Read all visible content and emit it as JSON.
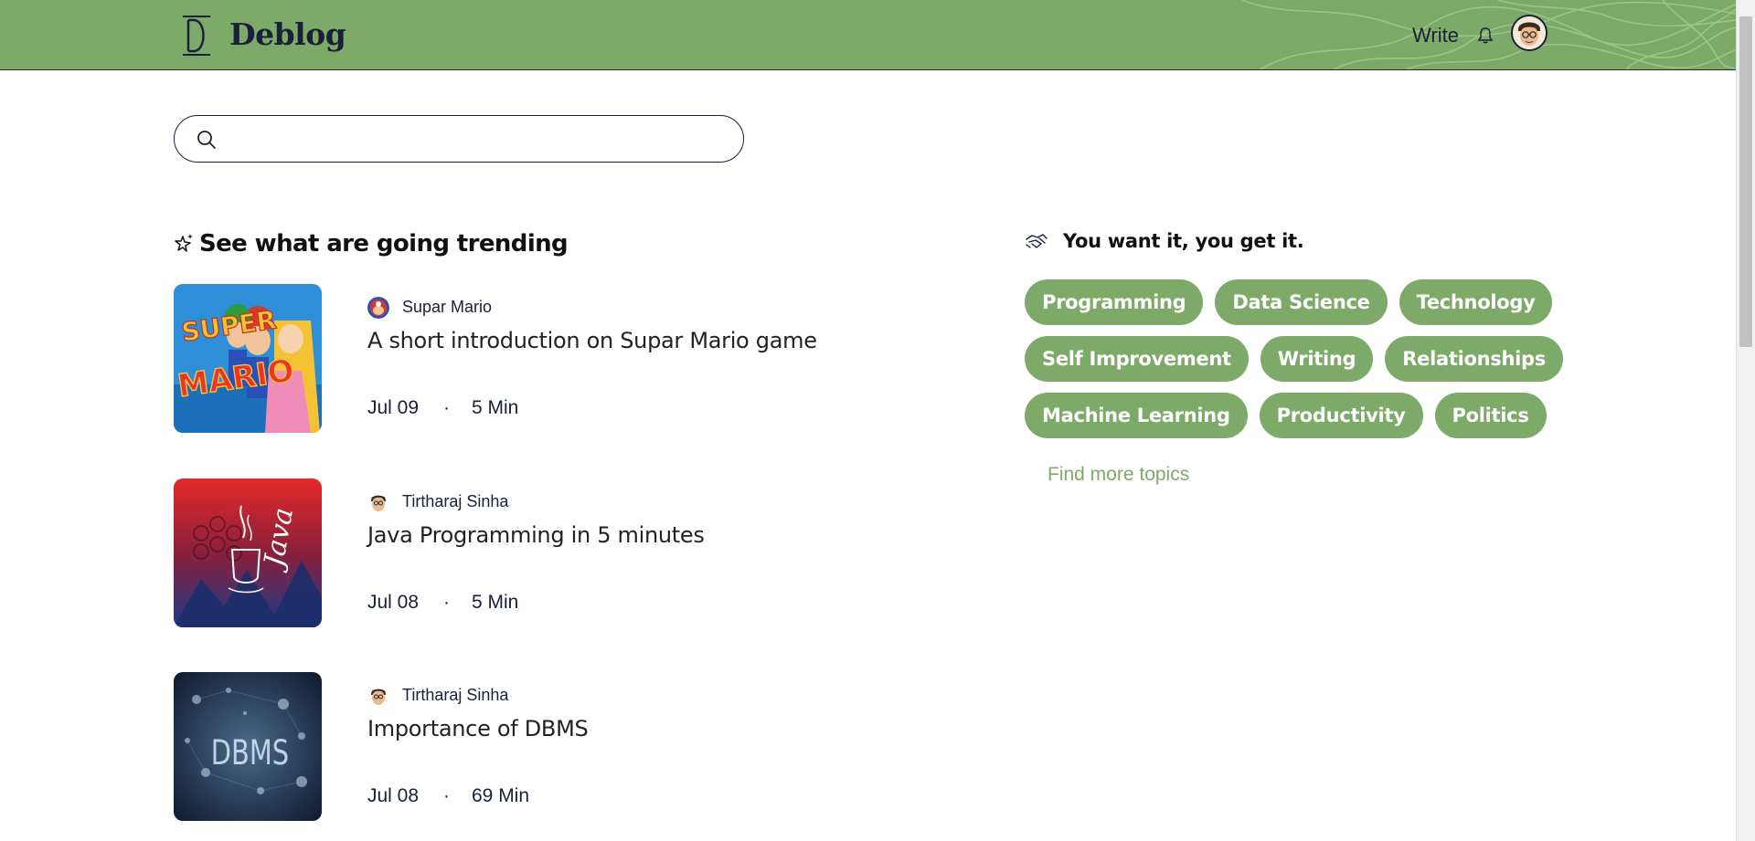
{
  "header": {
    "logo_text": "Deblog",
    "write_label": "Write"
  },
  "search": {
    "placeholder": ""
  },
  "trending": {
    "title": "See what are going trending",
    "posts": [
      {
        "author": "Supar Mario",
        "title": "A short introduction on Supar Mario game",
        "date": "Jul 09",
        "separator": "·",
        "read_time": "5 Min"
      },
      {
        "author": "Tirtharaj Sinha",
        "title": "Java Programming in 5 minutes",
        "date": "Jul 08",
        "separator": "·",
        "read_time": "5 Min"
      },
      {
        "author": "Tirtharaj Sinha",
        "title": "Importance of DBMS",
        "date": "Jul 08",
        "separator": "·",
        "read_time": "69 Min"
      }
    ]
  },
  "topics_section": {
    "title": "You want it, you get it.",
    "rows": [
      [
        "Programming",
        "Data Science",
        "Technology"
      ],
      [
        "Self Improvement",
        "Writing",
        "Relationships"
      ],
      [
        "Machine Learning",
        "Productivity",
        "Politics"
      ]
    ],
    "find_more": "Find more topics"
  },
  "colors": {
    "brand_green": "#7daa68",
    "navy": "#1a1f3a"
  },
  "thumb_texts": {
    "mario": "SUPER MARIO",
    "java": "Java",
    "dbms": "DBMS"
  }
}
